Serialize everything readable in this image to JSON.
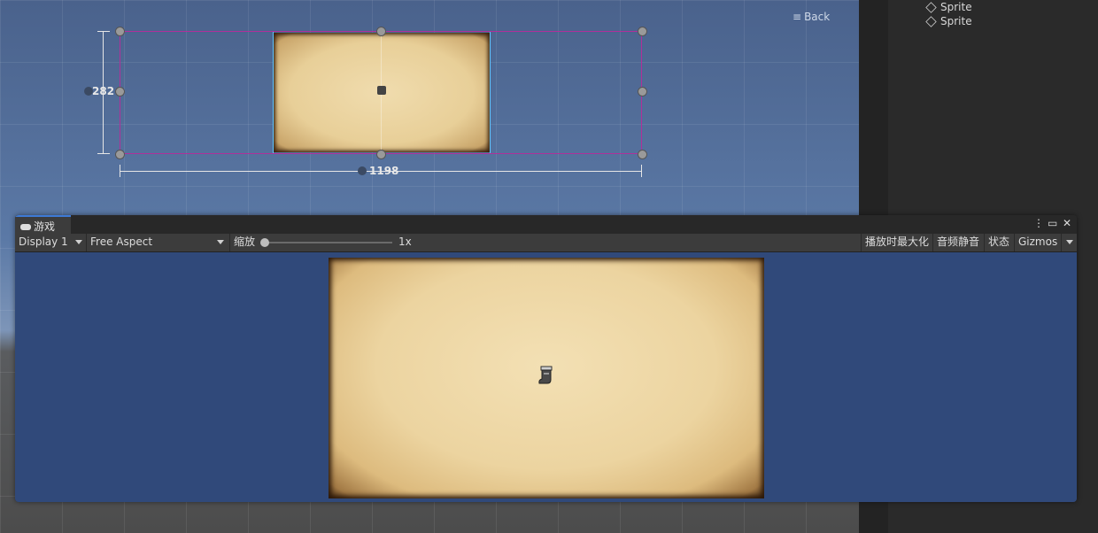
{
  "scene": {
    "back_label": "Back",
    "back_icon": "menu-lines-icon",
    "dim_height": "282",
    "dim_width": "1198"
  },
  "hierarchy": {
    "items": [
      {
        "label": "Sprite",
        "icon": "cube-icon"
      },
      {
        "label": "Sprite",
        "icon": "cube-icon"
      }
    ]
  },
  "game": {
    "tab_label": "游戏",
    "tab_icon": "gamepad-icon",
    "toolbar": {
      "display": "Display 1",
      "aspect": "Free Aspect",
      "scale_label": "缩放",
      "scale_value": "1x",
      "maximize_on_play": "播放时最大化",
      "mute_audio": "音频静音",
      "stats": "状态",
      "gizmos": "Gizmos"
    }
  },
  "colors": {
    "accent": "#3d7ad6",
    "selection": "#b0309a",
    "viewport_bg": "#30497a"
  }
}
